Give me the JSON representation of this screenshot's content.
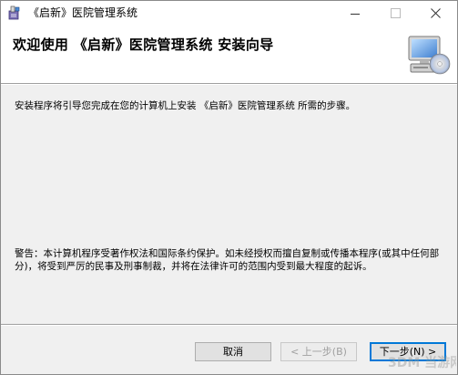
{
  "window": {
    "title": "《启新》医院管理系统"
  },
  "header": {
    "title": "欢迎使用 《启新》医院管理系统 安装向导"
  },
  "body": {
    "intro": "安装程序将引导您完成在您的计算机上安装 《启新》医院管理系统 所需的步骤。",
    "warning": "警告：本计算机程序受著作权法和国际条约保护。如未经授权而擅自复制或传播本程序(或其中任何部分)，将受到严厉的民事及刑事制裁，并将在法律许可的范围内受到最大程度的起诉。"
  },
  "buttons": {
    "cancel": "取消",
    "back": "< 上一步(B)",
    "next": "下一步(N) >"
  },
  "watermark": {
    "text": "3DM 当游网"
  },
  "colors": {
    "body_bg": "#f0f0f0",
    "default_button_border": "#0078d7"
  }
}
